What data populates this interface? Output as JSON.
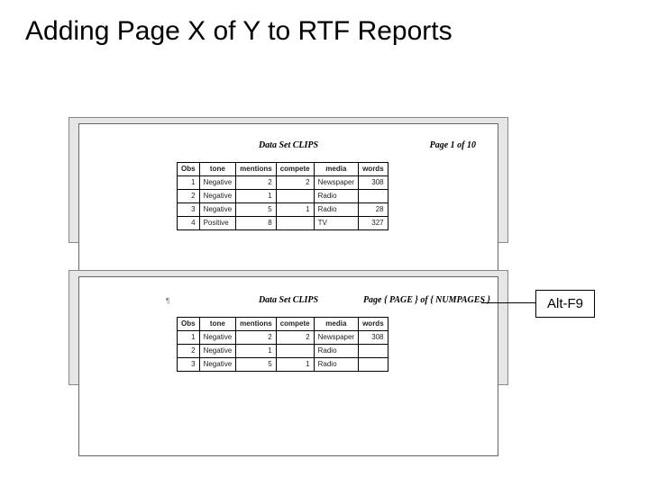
{
  "slide": {
    "title": "Adding Page X of Y to RTF Reports"
  },
  "report1": {
    "dataset_title": "Data Set CLIPS",
    "page_label": "Page 1 of 10",
    "columns": [
      "Obs",
      "tone",
      "mentions",
      "compete",
      "media",
      "words"
    ],
    "rows": [
      {
        "obs": "1",
        "tone": "Negative",
        "mentions": "2",
        "compete": "2",
        "media": "Newspaper",
        "words": "308"
      },
      {
        "obs": "2",
        "tone": "Negative",
        "mentions": "1",
        "compete": "",
        "media": "Radio",
        "words": ""
      },
      {
        "obs": "3",
        "tone": "Negative",
        "mentions": "5",
        "compete": "1",
        "media": "Radio",
        "words": "28"
      },
      {
        "obs": "4",
        "tone": "Positive",
        "mentions": "8",
        "compete": "",
        "media": "TV",
        "words": "327"
      }
    ]
  },
  "report2": {
    "dataset_title": "Data Set CLIPS",
    "page_label": "Page { PAGE } of { NUMPAGES }",
    "columns": [
      "Obs",
      "tone",
      "mentions",
      "compete",
      "media",
      "words"
    ],
    "rows": [
      {
        "obs": "1",
        "tone": "Negative",
        "mentions": "2",
        "compete": "2",
        "media": "Newspaper",
        "words": "308"
      },
      {
        "obs": "2",
        "tone": "Negative",
        "mentions": "1",
        "compete": "",
        "media": "Radio",
        "words": ""
      },
      {
        "obs": "3",
        "tone": "Negative",
        "mentions": "5",
        "compete": "1",
        "media": "Radio",
        "words": ""
      }
    ]
  },
  "callout": {
    "label": "Alt-F9"
  }
}
